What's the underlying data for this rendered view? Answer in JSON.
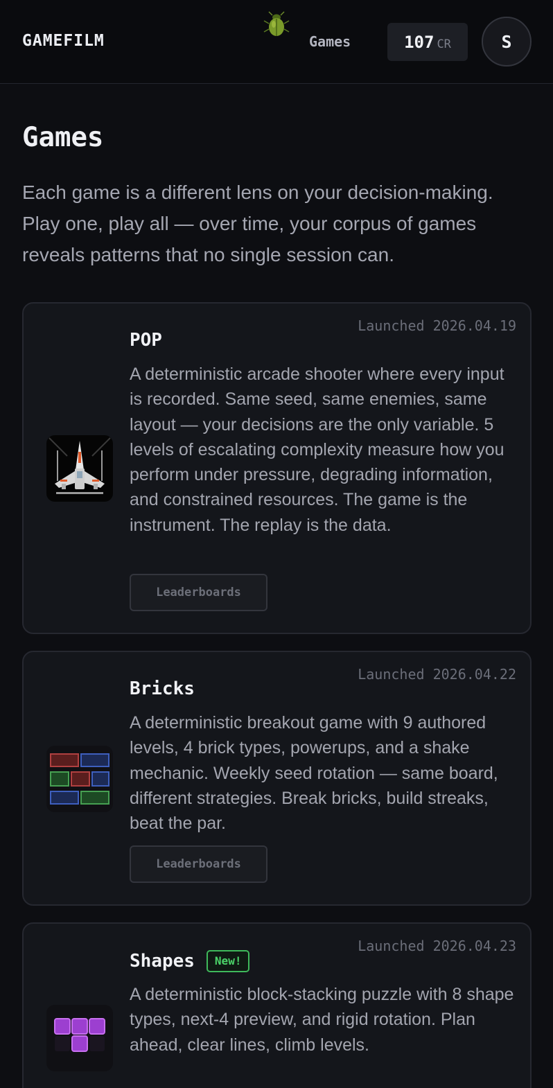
{
  "header": {
    "brand": "GAMEFILM",
    "nav_games": "Games",
    "credits_value": "107",
    "credits_unit": "CR",
    "avatar_initial": "S",
    "mascot_icon": "beetle-icon"
  },
  "page": {
    "title": "Games",
    "intro": "Each game is a different lens on your decision-making. Play one, play all — over time, your corpus of games reveals patterns that no single session can."
  },
  "games": [
    {
      "title": "POP",
      "launched": "Launched 2026.04.19",
      "description": "A deterministic arcade shooter where every input is recorded. Same seed, same enemies, same layout — your decisions are the only variable. 5 levels of escalating complexity measure how you perform under pressure, degrading information, and constrained resources. The game is the instrument. The replay is the data.",
      "button": "Leaderboards",
      "icon": "starfighter-icon"
    },
    {
      "title": "Bricks",
      "launched": "Launched 2026.04.22",
      "description": "A deterministic breakout game with 9 authored levels, 4 brick types, powerups, and a shake mechanic. Weekly seed rotation — same board, different strategies. Break bricks, build streaks, beat the par.",
      "button": "Leaderboards",
      "icon": "bricks-icon"
    },
    {
      "title": "Shapes",
      "badge": "New!",
      "launched": "Launched 2026.04.23",
      "description": "A deterministic block-stacking puzzle with 8 shape types, next-4 preview, and rigid rotation. Plan ahead, clear lines, climb levels.",
      "icon": "blocks-icon"
    }
  ],
  "colors": {
    "background": "#0d0e12",
    "card": "#14161b",
    "new_badge": "#4bd469"
  }
}
